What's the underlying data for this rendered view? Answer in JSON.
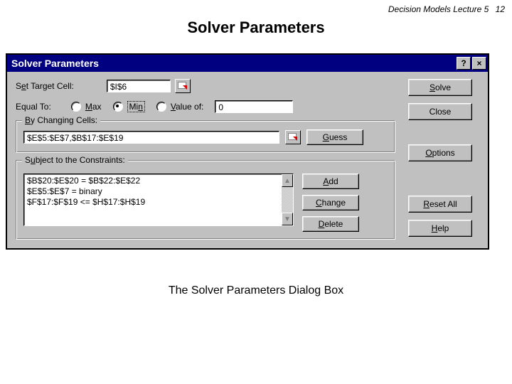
{
  "page": {
    "course_label": "Decision Models  Lecture 5",
    "page_number": "12",
    "slide_title": "Solver Parameters",
    "caption": "The Solver Parameters Dialog Box"
  },
  "window": {
    "title": "Solver Parameters"
  },
  "target": {
    "label": "Set Target Cell:",
    "value": "$I$6"
  },
  "equal": {
    "label": "Equal To:",
    "max": "Max",
    "min": "Min",
    "valueof": "Value of:",
    "value_input": "0"
  },
  "changing": {
    "legend": "By Changing Cells:",
    "value": "$E$5:$E$7,$B$17:$E$19",
    "guess": "Guess"
  },
  "constraints": {
    "legend": "Subject to the Constraints:",
    "items": [
      "$B$20:$E$20 = $B$22:$E$22",
      "$E$5:$E$7 = binary",
      "$F$17:$F$19 <= $H$17:$H$19"
    ],
    "add": "Add",
    "change": "Change",
    "delete": "Delete"
  },
  "buttons": {
    "solve": "Solve",
    "close": "Close",
    "options": "Options",
    "resetall": "Reset All",
    "help": "Help"
  },
  "titlebar": {
    "help": "?",
    "close": "×"
  },
  "scroll": {
    "up": "▲",
    "down": "▼"
  }
}
